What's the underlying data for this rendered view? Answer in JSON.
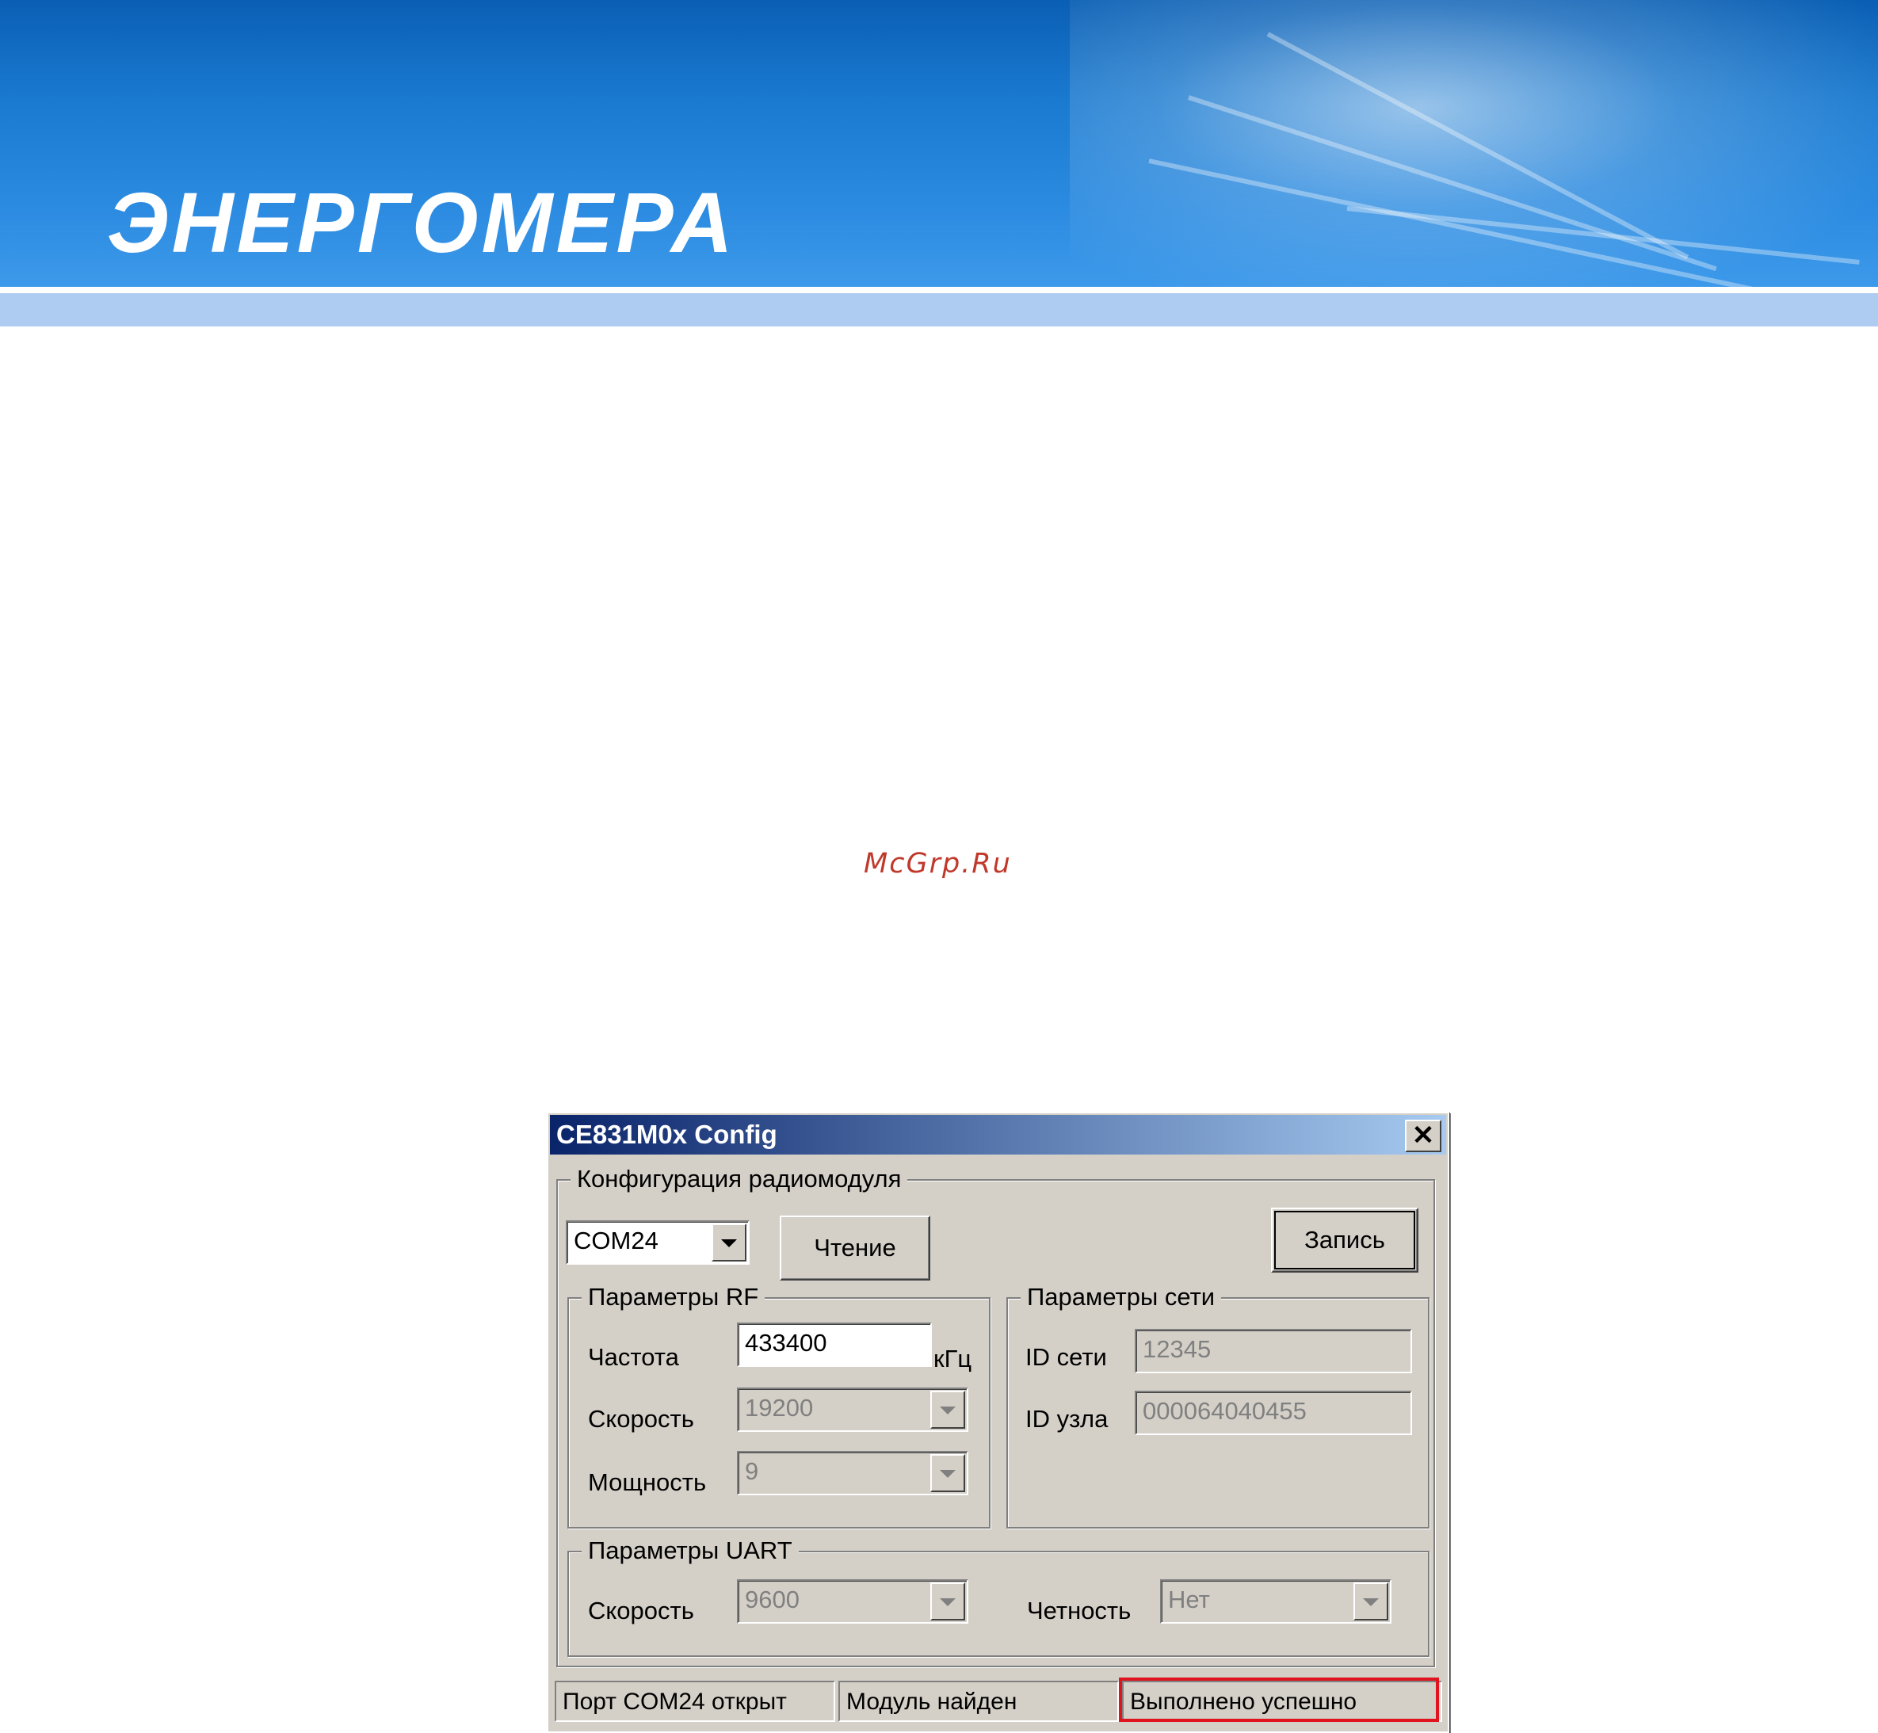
{
  "header": {
    "logo_text": "ЭНЕРГОМЕРА",
    "colors": {
      "banner": "#1a7ad0",
      "band": "#aecbf2"
    }
  },
  "watermark": "McGrp.Ru",
  "dialog": {
    "title": "CE831M0x Config",
    "close_icon": "close-icon",
    "config_group": {
      "label": "Конфигурация радиомодуля",
      "port_value": "COM24",
      "read_button": "Чтение",
      "write_button": "Запись"
    },
    "rf_group": {
      "label": "Параметры RF",
      "freq_label": "Частота",
      "freq_value": "433400",
      "freq_unit": "кГц",
      "speed_label": "Скорость",
      "speed_value": "19200",
      "power_label": "Мощность",
      "power_value": "9"
    },
    "net_group": {
      "label": "Параметры сети",
      "net_id_label": "ID сети",
      "net_id_value": "12345",
      "node_id_label": "ID узла",
      "node_id_value": "000064040455"
    },
    "uart_group": {
      "label": "Параметры UART",
      "speed_label": "Скорость",
      "speed_value": "9600",
      "parity_label": "Четность",
      "parity_value": "Нет"
    },
    "status_bar": {
      "port": "Порт COM24 открыт",
      "module": "Модуль найден",
      "result": "Выполнено успешно",
      "highlight_color": "#e0141e"
    }
  }
}
